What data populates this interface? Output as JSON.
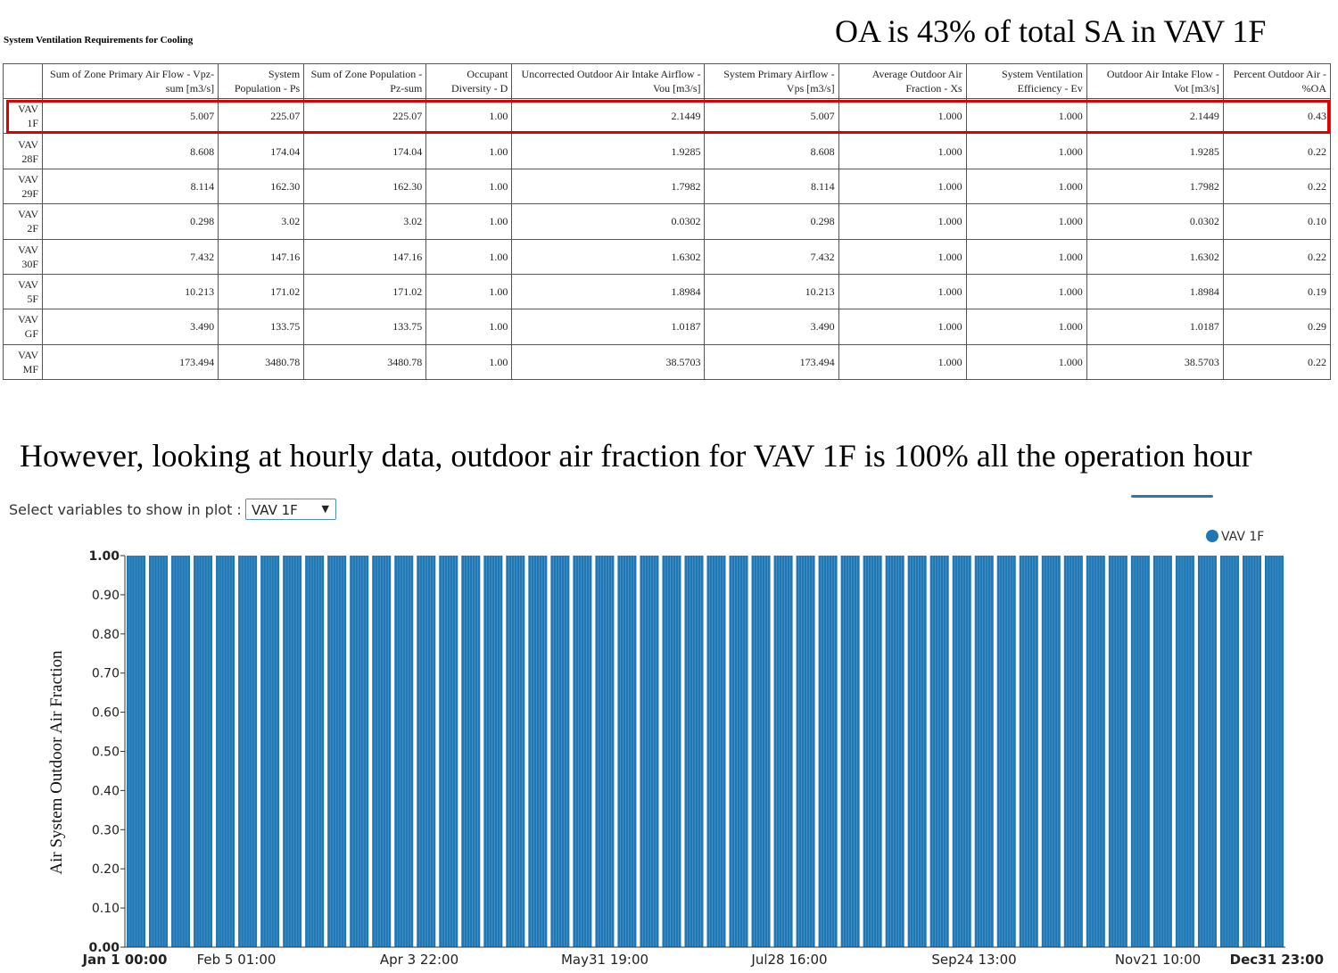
{
  "table_title": "System Ventilation Requirements for Cooling",
  "annotation_top": "OA is 43% of total SA in VAV 1F",
  "annotation_mid": "However, looking at hourly data, outdoor air fraction for VAV 1F is 100% all the operation hour",
  "table": {
    "headers": [
      "",
      "Sum of Zone Primary Air Flow - Vpz-sum [m3/s]",
      "System Population - Ps",
      "Sum of Zone Population - Pz-sum",
      "Occupant Diversity - D",
      "Uncorrected Outdoor Air Intake Airflow - Vou [m3/s]",
      "System Primary Airflow - Vps [m3/s]",
      "Average Outdoor Air Fraction - Xs",
      "System Ventilation Efficiency - Ev",
      "Outdoor Air Intake Flow - Vot [m3/s]",
      "Percent Outdoor Air - %OA"
    ],
    "rows": [
      [
        "VAV 1F",
        "5.007",
        "225.07",
        "225.07",
        "1.00",
        "2.1449",
        "5.007",
        "1.000",
        "1.000",
        "2.1449",
        "0.43"
      ],
      [
        "VAV 28F",
        "8.608",
        "174.04",
        "174.04",
        "1.00",
        "1.9285",
        "8.608",
        "1.000",
        "1.000",
        "1.9285",
        "0.22"
      ],
      [
        "VAV 29F",
        "8.114",
        "162.30",
        "162.30",
        "1.00",
        "1.7982",
        "8.114",
        "1.000",
        "1.000",
        "1.7982",
        "0.22"
      ],
      [
        "VAV 2F",
        "0.298",
        "3.02",
        "3.02",
        "1.00",
        "0.0302",
        "0.298",
        "1.000",
        "1.000",
        "0.0302",
        "0.10"
      ],
      [
        "VAV 30F",
        "7.432",
        "147.16",
        "147.16",
        "1.00",
        "1.6302",
        "7.432",
        "1.000",
        "1.000",
        "1.6302",
        "0.22"
      ],
      [
        "VAV 5F",
        "10.213",
        "171.02",
        "171.02",
        "1.00",
        "1.8984",
        "10.213",
        "1.000",
        "1.000",
        "1.8984",
        "0.19"
      ],
      [
        "VAV GF",
        "3.490",
        "133.75",
        "133.75",
        "1.00",
        "1.0187",
        "3.490",
        "1.000",
        "1.000",
        "1.0187",
        "0.29"
      ],
      [
        "VAV MF",
        "173.494",
        "3480.78",
        "3480.78",
        "1.00",
        "38.5703",
        "173.494",
        "1.000",
        "1.000",
        "38.5703",
        "0.22"
      ]
    ]
  },
  "plot_controls": {
    "label": "Select variables to show in plot :",
    "selected": "VAV 1F"
  },
  "colors": {
    "series": "#1f77b4",
    "highlight": "#e00000"
  },
  "chart_data": {
    "type": "bar",
    "series": [
      {
        "name": "VAV 1F",
        "value_all_operating_hours": 1.0
      }
    ],
    "ylabel": "Air System Outdoor Air Fraction",
    "ylim": [
      0,
      1.0
    ],
    "y_ticks": [
      "0.00",
      "0.10",
      "0.20",
      "0.30",
      "0.40",
      "0.50",
      "0.60",
      "0.70",
      "0.80",
      "0.90",
      "1.00"
    ],
    "x_ticks": [
      "Jan 1 00:00",
      "Feb 5 01:00",
      "Apr 3 22:00",
      "May31 19:00",
      "Jul28 16:00",
      "Sep24 13:00",
      "Nov21 10:00",
      "Dec31 23:00"
    ],
    "bar_groups": 52,
    "legend": "top-right"
  }
}
